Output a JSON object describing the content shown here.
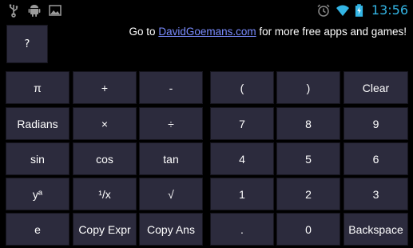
{
  "status_bar": {
    "icons_left": [
      "usb-icon",
      "android-icon",
      "image-icon"
    ],
    "icons_right": [
      "alarm-icon",
      "wifi-icon",
      "battery-charging-icon"
    ],
    "time": "13:56",
    "clock_color": "#33b5e5"
  },
  "help": {
    "button_label": "?",
    "promo_prefix": "Go to ",
    "promo_link": "DavidGoemans.com",
    "promo_suffix": " for more free apps and games!"
  },
  "keypad": {
    "left": [
      [
        "π",
        "+",
        "-"
      ],
      [
        "Radians",
        "×",
        "÷"
      ],
      [
        "sin",
        "cos",
        "tan"
      ],
      [
        "yª",
        "¹/x",
        "√"
      ],
      [
        "e",
        "Copy Expr",
        "Copy Ans"
      ]
    ],
    "right": [
      [
        "(",
        ")",
        "Clear"
      ],
      [
        "7",
        "8",
        "9"
      ],
      [
        "4",
        "5",
        "6"
      ],
      [
        "1",
        "2",
        "3"
      ],
      [
        ".",
        "0",
        "Backspace"
      ]
    ]
  },
  "colors": {
    "background": "#000000",
    "key": "#2c2b3d",
    "key_border": "#16151e",
    "link": "#7a8cff"
  }
}
